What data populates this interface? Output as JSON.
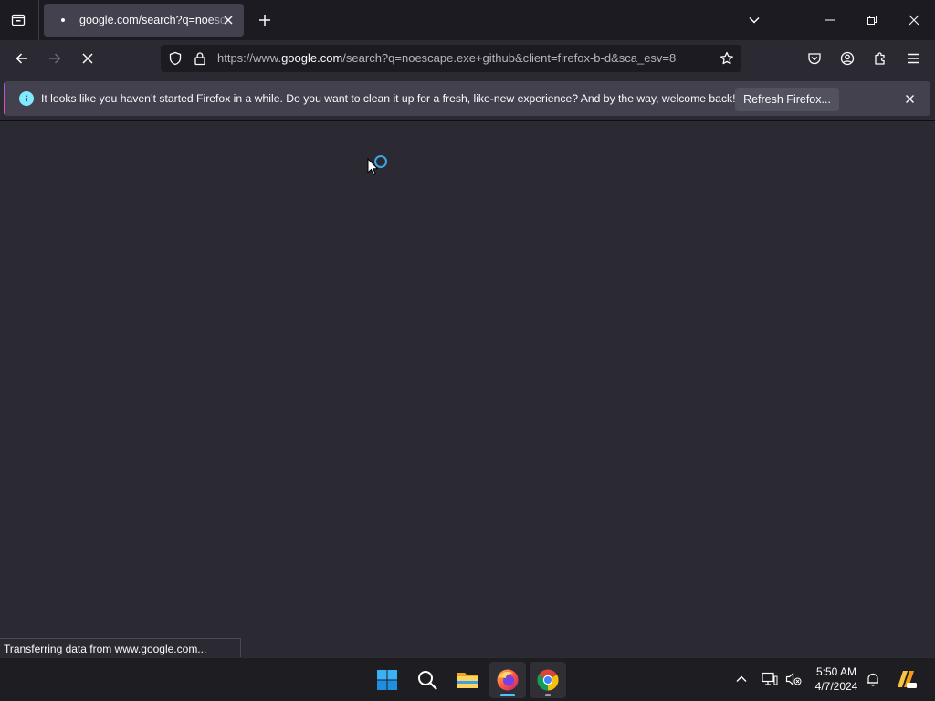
{
  "browser": {
    "tab": {
      "title": "google.com/search?q=noescape.exe"
    },
    "url": {
      "scheme": "https://www.",
      "host": "google.com",
      "path": "/search?q=noescape.exe+github&client=firefox-b-d&sca_esv=8"
    },
    "notification": {
      "message": "It looks like you haven’t started Firefox in a while. Do you want to clean it up for a fresh, like-new experience? And by the way, welcome back!",
      "button_label": "Refresh Firefox..."
    },
    "status_text": "Transferring data from www.google.com..."
  },
  "icons": {
    "tab_list": "firefox-view-icon",
    "tab_close": "close-icon",
    "new_tab": "plus-icon",
    "all_tabs": "chevron-down-icon",
    "back": "back-arrow-icon",
    "forward": "forward-arrow-icon",
    "stop": "stop-icon",
    "tracking_protection": "shield-icon",
    "lock": "lock-icon",
    "bookmark": "star-icon",
    "pocket": "pocket-icon",
    "account": "account-icon",
    "extensions": "puzzle-icon",
    "menu": "hamburger-menu-icon"
  },
  "taskbar": {
    "apps": [
      "start",
      "search",
      "file-explorer",
      "firefox",
      "chrome"
    ],
    "clock": {
      "time": "5:50 AM",
      "date": "4/7/2024"
    }
  },
  "colors": {
    "chrome_dark": "#1c1b22",
    "toolbar": "#2b2a33",
    "tab_selected": "#42414d",
    "info_accent": "#80ebff",
    "spinner": "#3ea5e8"
  }
}
